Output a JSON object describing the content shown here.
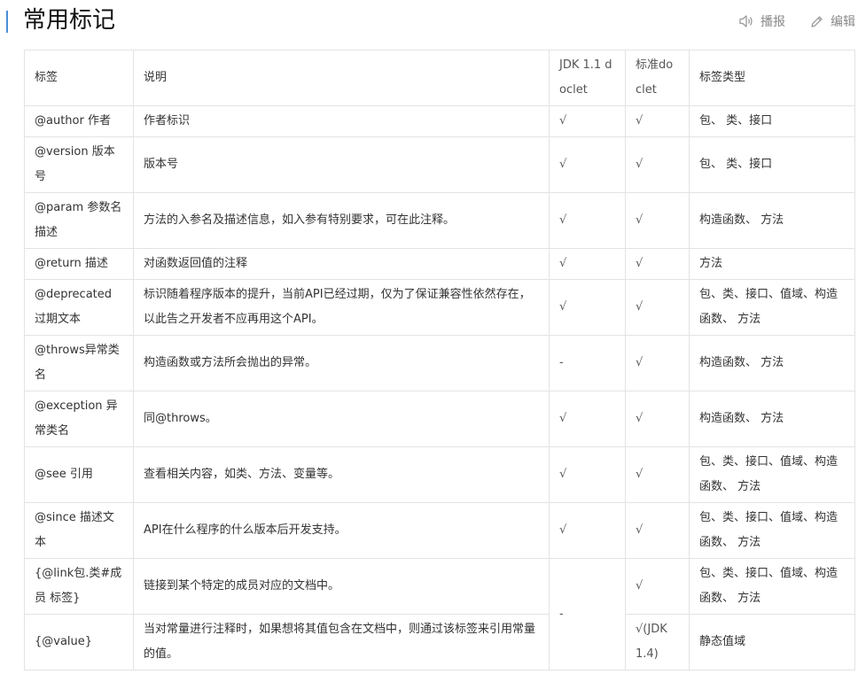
{
  "header": {
    "title": "常用标记",
    "actions": [
      {
        "label": "播报",
        "icon": "speaker-icon"
      },
      {
        "label": "编辑",
        "icon": "pencil-icon"
      }
    ]
  },
  "table": {
    "columns": [
      "标签",
      "说明",
      "JDK 1.1 doclet",
      "标准doclet",
      "标签类型"
    ],
    "rows": [
      {
        "tag": "@author 作者",
        "desc": "作者标识",
        "jdk": "√",
        "std": "√",
        "type": "包、 类、接口"
      },
      {
        "tag": "@version 版本号",
        "desc": "版本号",
        "jdk": "√",
        "std": "√",
        "type": "包、 类、接口"
      },
      {
        "tag": "@param 参数名 描述",
        "desc": "方法的入参名及描述信息，如入参有特别要求，可在此注释。",
        "jdk": "√",
        "std": "√",
        "type": "构造函数、 方法"
      },
      {
        "tag": "@return 描述",
        "desc": "对函数返回值的注释",
        "jdk": "√",
        "std": "√",
        "type": "方法"
      },
      {
        "tag": "@deprecated 过期文本",
        "desc": "标识随着程序版本的提升，当前API已经过期，仅为了保证兼容性依然存在，以此告之开发者不应再用这个API。",
        "jdk": "√",
        "std": "√",
        "type": "包、类、接口、值域、构造函数、 方法"
      },
      {
        "tag": "@throws异常类名",
        "desc": "构造函数或方法所会抛出的异常。",
        "jdk": "-",
        "std": "√",
        "type": "构造函数、 方法"
      },
      {
        "tag": "@exception 异常类名",
        "desc": "同@throws。",
        "jdk": "√",
        "std": "√",
        "type": "构造函数、 方法"
      },
      {
        "tag": "@see 引用",
        "desc": "查看相关内容，如类、方法、变量等。",
        "jdk": "√",
        "std": "√",
        "type": "包、类、接口、值域、构造函数、 方法"
      },
      {
        "tag": "@since 描述文本",
        "desc": "API在什么程序的什么版本后开发支持。",
        "jdk": "√",
        "std": "√",
        "type": "包、类、接口、值域、构造函数、 方法"
      },
      {
        "tag": "{@link包.类#成员 标签}",
        "desc": "链接到某个特定的成员对应的文档中。",
        "jdk": "-",
        "std": "√",
        "type": "包、类、接口、值域、构造函数、 方法"
      },
      {
        "tag": "{@value}",
        "desc": "当对常量进行注释时，如果想将其值包含在文档中，则通过该标签来引用常量的值。",
        "std": "√(JDK 1.4)",
        "type": "静态值域"
      }
    ]
  }
}
